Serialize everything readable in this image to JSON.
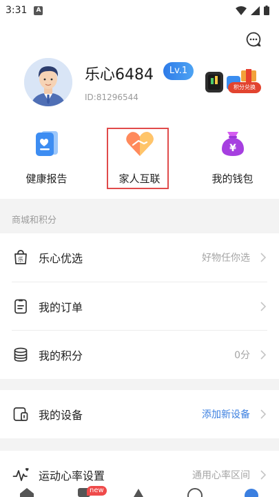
{
  "status_bar": {
    "time": "3:31",
    "notification": "A"
  },
  "profile": {
    "username": "乐心6484",
    "level": "Lv.1",
    "user_id": "ID:81296544",
    "promo_label": "积分兑换"
  },
  "quick_actions": [
    {
      "label": "健康报告",
      "icon": "health-report-icon"
    },
    {
      "label": "家人互联",
      "icon": "family-link-icon"
    },
    {
      "label": "我的钱包",
      "icon": "wallet-icon"
    }
  ],
  "section_header": "商城和积分",
  "rows": {
    "mall": {
      "label": "乐心优选",
      "value": "好物任你选",
      "icon": "shop-bag-icon"
    },
    "orders": {
      "label": "我的订单",
      "value": "",
      "icon": "order-icon"
    },
    "points": {
      "label": "我的积分",
      "value": "0分",
      "icon": "coins-icon"
    },
    "devices": {
      "label": "我的设备",
      "value": "添加新设备",
      "icon": "device-icon"
    },
    "heart_rate": {
      "label": "运动心率设置",
      "value": "通用心率区间",
      "icon": "heart-rate-icon"
    }
  },
  "tabbar": {
    "new_badge": "new"
  },
  "colors": {
    "accent_blue": "#3b7fe0",
    "highlight_red": "#e04a4a",
    "badge_red": "#ef4a4a"
  }
}
